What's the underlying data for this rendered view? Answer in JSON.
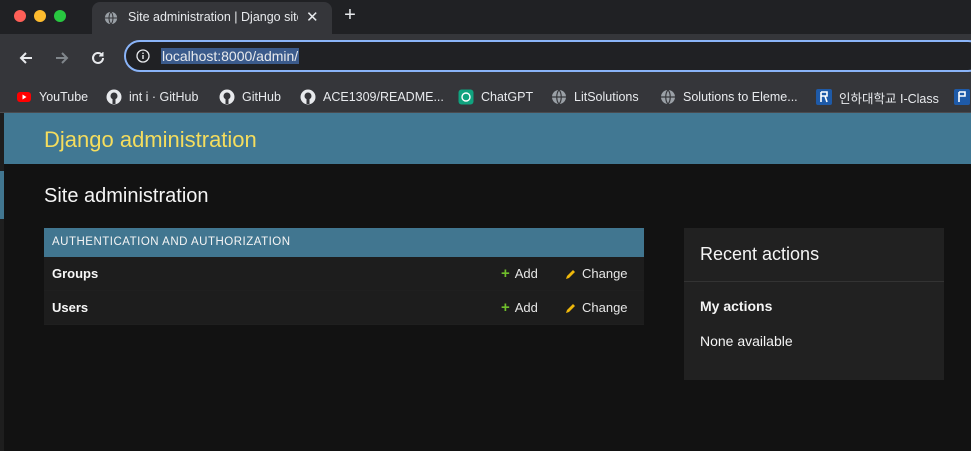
{
  "browser": {
    "tab_title": "Site administration | Django site admin",
    "new_tab_symbol": "+",
    "close_symbol": "✕",
    "url": "localhost:8000/admin/"
  },
  "bookmarks": [
    {
      "label": "YouTube",
      "icon": "youtube-icon"
    },
    {
      "label": "int i · GitHub",
      "icon": "github-icon"
    },
    {
      "label": "GitHub",
      "icon": "github-icon"
    },
    {
      "label": "ACE1309/README...",
      "icon": "github-icon"
    },
    {
      "label": "ChatGPT",
      "icon": "chatgpt-icon"
    },
    {
      "label": "LitSolutions",
      "icon": "globe-icon"
    },
    {
      "label": "Solutions to Eleme...",
      "icon": "globe-icon"
    },
    {
      "label": "인하대학교 I-Class",
      "icon": "iclass-icon"
    }
  ],
  "admin": {
    "brand": "Django administration",
    "site_title": "Site administration",
    "module": {
      "caption": "AUTHENTICATION AND AUTHORIZATION",
      "rows": [
        {
          "model": "Groups",
          "add": "Add",
          "change": "Change"
        },
        {
          "model": "Users",
          "add": "Add",
          "change": "Change"
        }
      ]
    },
    "recent": {
      "title": "Recent actions",
      "subtitle": "My actions",
      "empty": "None available"
    }
  },
  "colors": {
    "header": "#417893",
    "brand_text": "#f5dd5d",
    "add_icon": "#70bf2b",
    "change_icon": "#efb80b"
  }
}
